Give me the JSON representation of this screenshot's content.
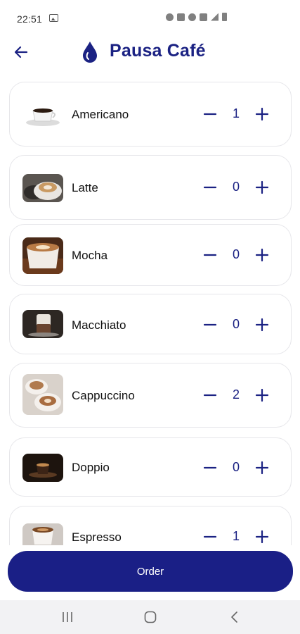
{
  "status_bar": {
    "time": "22:51"
  },
  "header": {
    "title": "Pausa Café"
  },
  "colors": {
    "brand": "#1b2283",
    "order_button": "#1a1f86",
    "card_border": "#e6e6ea"
  },
  "items": [
    {
      "name": "Americano",
      "qty": "1",
      "thumb": "espresso-cup-on-saucer"
    },
    {
      "name": "Latte",
      "qty": "0",
      "thumb": "latte-cup"
    },
    {
      "name": "Mocha",
      "qty": "0",
      "thumb": "mocha-mug"
    },
    {
      "name": "Macchiato",
      "qty": "0",
      "thumb": "macchiato-glass"
    },
    {
      "name": "Cappuccino",
      "qty": "2",
      "thumb": "cappuccino-cups"
    },
    {
      "name": "Doppio",
      "qty": "0",
      "thumb": "doppio-cup"
    },
    {
      "name": "Espresso",
      "qty": "1",
      "thumb": "espresso-cup"
    }
  ],
  "order": {
    "label": "Order"
  }
}
